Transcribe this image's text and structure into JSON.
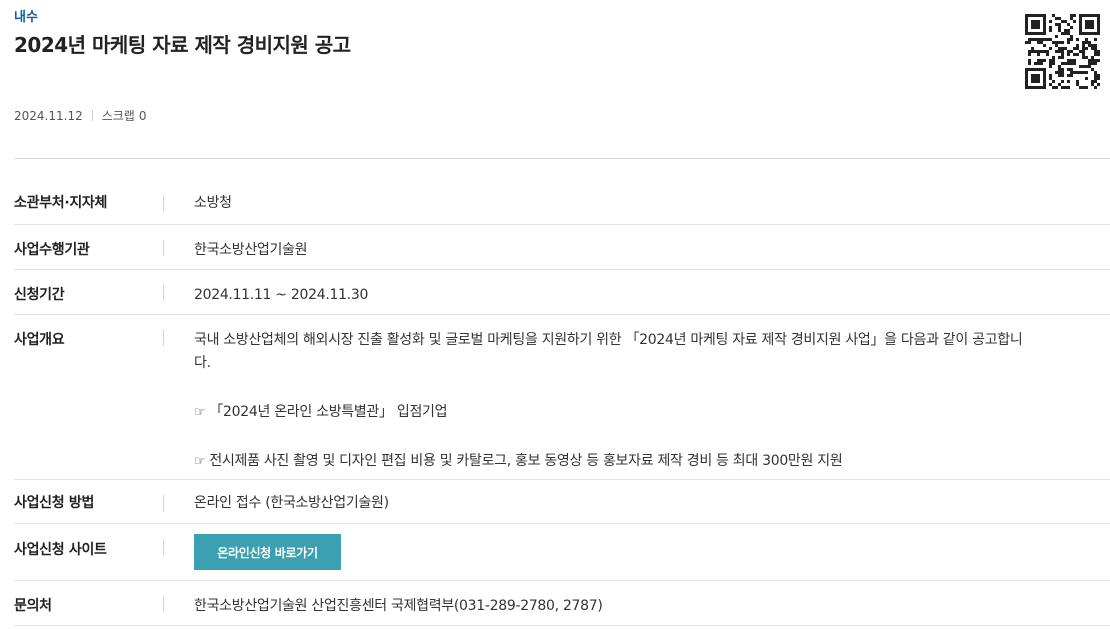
{
  "category": "내수",
  "title": "2024년 마케팅 자료 제작 경비지원 공고",
  "meta": {
    "date": "2024.11.12",
    "scrap_label": "스크랩",
    "scrap_count": "0"
  },
  "rows": {
    "ministry": {
      "label": "소관부처·지자체",
      "value": "소방청"
    },
    "agency": {
      "label": "사업수행기관",
      "value": "한국소방산업기술원"
    },
    "period": {
      "label": "신청기간",
      "value": "2024.11.11 ~ 2024.11.30"
    },
    "overview": {
      "label": "사업개요",
      "intro_1": "국내 소방산업체의 해외시장 진출 활성화 및 글로벌 마케팅을 지원하기 위한 「2024년 마케팅 자료 제작 경비지원 사업」을 다음과 같이 공고합니",
      "intro_2": "다.",
      "bullet_icon": "☞",
      "bullet_1": "「2024년 온라인 소방특별관」 입점기업",
      "bullet_2": "전시제품 사진 촬영 및 디자인 편집 비용 및 카탈로그, 홍보 동영상 등 홍보자료 제작 경비 등 최대 300만원 지원"
    },
    "method": {
      "label": "사업신청 방법",
      "value": "온라인 접수 (한국소방산업기술원)"
    },
    "site": {
      "label": "사업신청 사이트",
      "button": "온라인신청 바로가기"
    },
    "contact": {
      "label": "문의처",
      "value": "한국소방산업기술원 산업진흥센터 국제협력부(031-289-2780, 2787)"
    }
  },
  "colors": {
    "category": "#0b5ea8",
    "button": "#3aa0b2"
  },
  "icons": {
    "qr": "qr-code-icon",
    "bullet": "pointing-hand-icon"
  }
}
